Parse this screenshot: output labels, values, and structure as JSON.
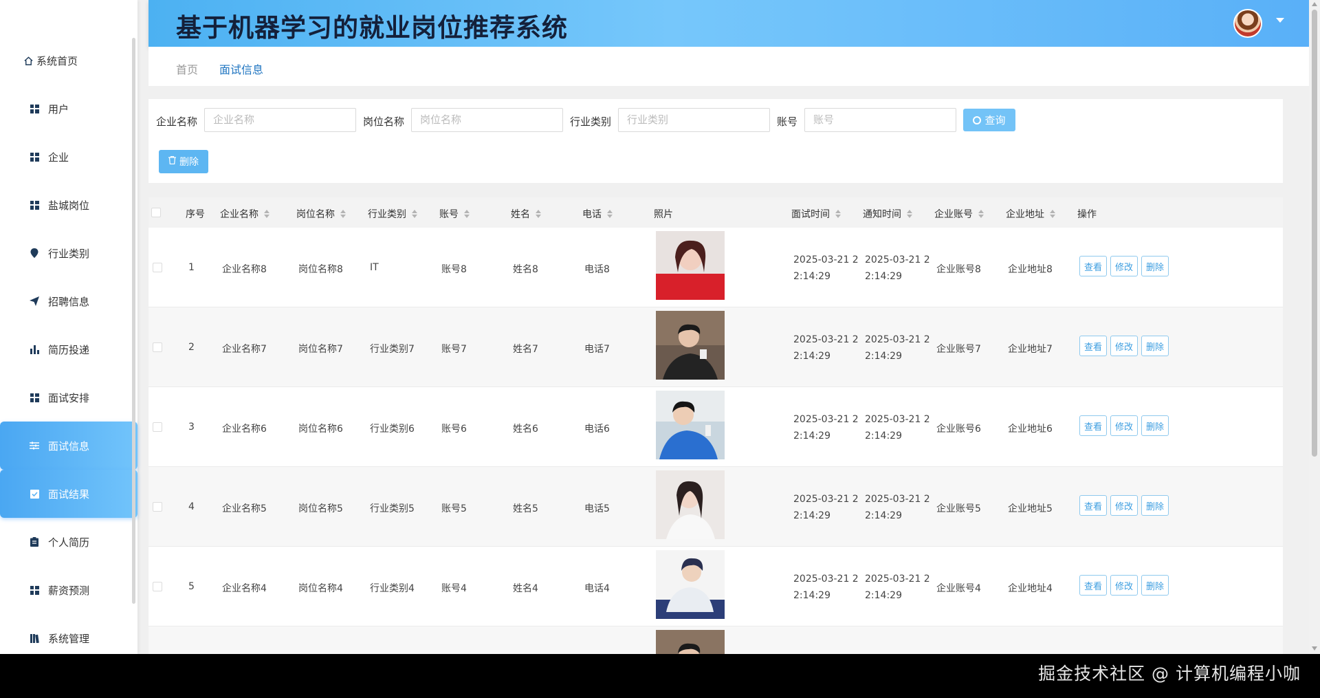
{
  "app": {
    "title": "基于机器学习的就业岗位推荐系统"
  },
  "colors": {
    "accent": "#4aa7f2",
    "header_start": "#4cb1f2",
    "header_end": "#59b0f8",
    "button_border": "#8ec9ee"
  },
  "sidebar": {
    "items": [
      {
        "label": "系统首页",
        "icon": "home-icon"
      },
      {
        "label": "用户",
        "icon": "grid-icon"
      },
      {
        "label": "企业",
        "icon": "grid-icon"
      },
      {
        "label": "盐城岗位",
        "icon": "grid-icon"
      },
      {
        "label": "行业类别",
        "icon": "location-pin-icon"
      },
      {
        "label": "招聘信息",
        "icon": "send-icon"
      },
      {
        "label": "简历投递",
        "icon": "bar-chart-icon"
      },
      {
        "label": "面试安排",
        "icon": "grid-icon"
      },
      {
        "label": "面试信息",
        "icon": "sliders-icon",
        "active": true
      },
      {
        "label": "面试结果",
        "icon": "checkbox-icon",
        "active": true
      },
      {
        "label": "个人简历",
        "icon": "clipboard-icon"
      },
      {
        "label": "薪资预测",
        "icon": "grid-icon"
      },
      {
        "label": "系统管理",
        "icon": "book-icon"
      }
    ]
  },
  "breadcrumb": {
    "home": "首页",
    "current": "面试信息"
  },
  "search": {
    "fields": [
      {
        "label": "企业名称",
        "placeholder": "企业名称"
      },
      {
        "label": "岗位名称",
        "placeholder": "岗位名称"
      },
      {
        "label": "行业类别",
        "placeholder": "行业类别"
      },
      {
        "label": "账号",
        "placeholder": "账号"
      }
    ],
    "query_label": "查询",
    "delete_label": "删除"
  },
  "table": {
    "headers": [
      "序号",
      "企业名称",
      "岗位名称",
      "行业类别",
      "账号",
      "姓名",
      "电话",
      "照片",
      "面试时间",
      "通知时间",
      "企业账号",
      "企业地址",
      "操作"
    ],
    "actions": {
      "view": "查看",
      "edit": "修改",
      "delete": "删除"
    },
    "rows": [
      {
        "index": "1",
        "company": "企业名称8",
        "position": "岗位名称8",
        "industry": "IT",
        "account": "账号8",
        "name": "姓名8",
        "phone": "电话8",
        "interview_time": "2025-03-21 22:14:29",
        "notice_time": "2025-03-21 22:14:29",
        "company_account": "企业账号8",
        "company_address": "企业地址8"
      },
      {
        "index": "2",
        "company": "企业名称7",
        "position": "岗位名称7",
        "industry": "行业类别7",
        "account": "账号7",
        "name": "姓名7",
        "phone": "电话7",
        "interview_time": "2025-03-21 22:14:29",
        "notice_time": "2025-03-21 22:14:29",
        "company_account": "企业账号7",
        "company_address": "企业地址7"
      },
      {
        "index": "3",
        "company": "企业名称6",
        "position": "岗位名称6",
        "industry": "行业类别6",
        "account": "账号6",
        "name": "姓名6",
        "phone": "电话6",
        "interview_time": "2025-03-21 22:14:29",
        "notice_time": "2025-03-21 22:14:29",
        "company_account": "企业账号6",
        "company_address": "企业地址6"
      },
      {
        "index": "4",
        "company": "企业名称5",
        "position": "岗位名称5",
        "industry": "行业类别5",
        "account": "账号5",
        "name": "姓名5",
        "phone": "电话5",
        "interview_time": "2025-03-21 22:14:29",
        "notice_time": "2025-03-21 22:14:29",
        "company_account": "企业账号5",
        "company_address": "企业地址5"
      },
      {
        "index": "5",
        "company": "企业名称4",
        "position": "岗位名称4",
        "industry": "行业类别4",
        "account": "账号4",
        "name": "姓名4",
        "phone": "电话4",
        "interview_time": "2025-03-21 22:14:29",
        "notice_time": "2025-03-21 22:14:29",
        "company_account": "企业账号4",
        "company_address": "企业地址4"
      }
    ]
  },
  "watermark": "掘金技术社区 @ 计算机编程小咖"
}
